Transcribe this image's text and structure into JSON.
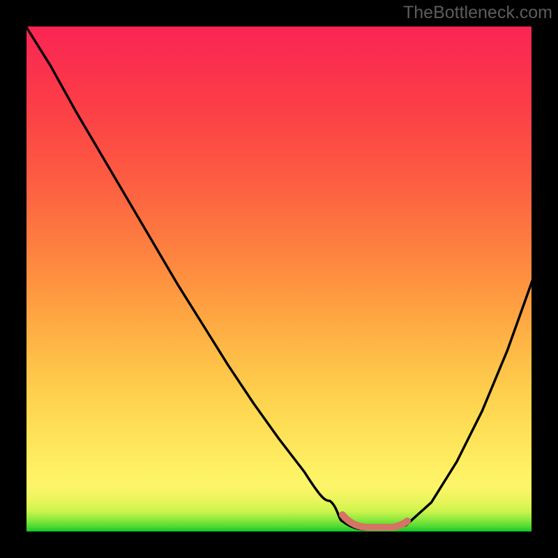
{
  "watermark": "TheBottleneck.com",
  "chart_data": {
    "type": "line",
    "title": "",
    "xlabel": "",
    "ylabel": "",
    "xlim": [
      0,
      100
    ],
    "ylim": [
      0,
      100
    ],
    "x": [
      0,
      5,
      10,
      15,
      20,
      25,
      30,
      35,
      40,
      45,
      50,
      55,
      60,
      62.5,
      65,
      67.5,
      70,
      72.5,
      75,
      80,
      85,
      90,
      95,
      100
    ],
    "values": [
      100,
      92,
      83,
      74.5,
      66,
      57.5,
      49,
      41,
      33,
      25.5,
      18.5,
      12,
      6.3,
      4,
      2.3,
      1.2,
      0.7,
      0.7,
      1.5,
      6,
      14,
      24,
      36,
      50
    ],
    "accent_segment": {
      "x": [
        62.5,
        65,
        67.5,
        70,
        72.5,
        75
      ],
      "values": [
        4,
        2.3,
        1.2,
        0.7,
        0.7,
        1.5
      ]
    },
    "colors": {
      "gradient_top": "#fa2951",
      "gradient_mid": "#fedc54",
      "gradient_bottom": "#14c52d",
      "curve": "#000000",
      "accent": "#d37465",
      "watermark": "#5c5c5c",
      "frame": "#000000"
    }
  }
}
